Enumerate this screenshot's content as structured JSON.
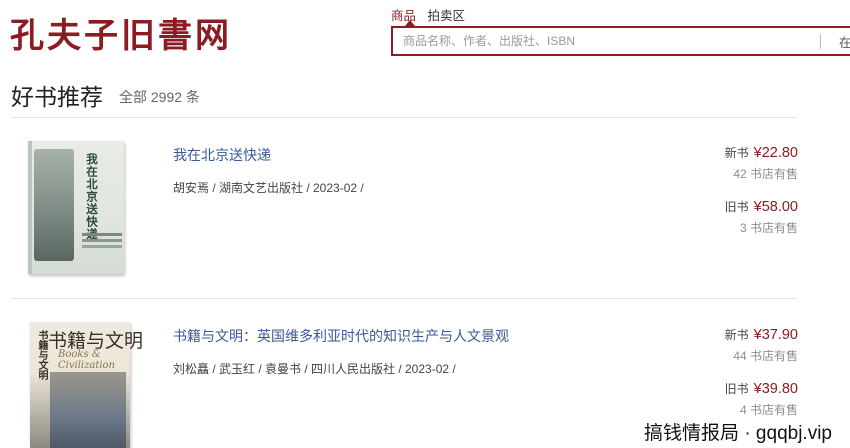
{
  "header": {
    "logo_text": "孔夫子旧書网",
    "search_tabs": [
      "商品",
      "拍卖区"
    ],
    "search_placeholder": "商品名称、作者、出版社、ISBN",
    "search_scope": "在"
  },
  "section": {
    "title": "好书推荐",
    "count_text": "全部 2992 条"
  },
  "books": [
    {
      "title": "我在北京送快递",
      "meta": "胡安焉 / 湖南文艺出版社 / 2023-02 /",
      "cover_title": "我在北京送快递",
      "new_label": "新书",
      "new_price": "¥22.80",
      "new_sellers": "42 书店有售",
      "used_label": "旧书",
      "used_price": "¥58.00",
      "used_sellers": "3 书店有售"
    },
    {
      "title": "书籍与文明：英国维多利亚时代的知识生产与人文景观",
      "meta": "刘松矗 / 武玉红 / 袁曼书 / 四川人民出版社 / 2023-02 /",
      "cover_title": "书籍与文明",
      "cover_subtitle": "Books & Civilization",
      "new_label": "新书",
      "new_price": "¥37.90",
      "new_sellers": "44 书店有售",
      "used_label": "旧书",
      "used_price": "¥39.80",
      "used_sellers": "4 书店有售"
    }
  ],
  "watermark": "搞钱情报局 · gqqbj.vip",
  "colors": {
    "brand": "#8a1c22",
    "link": "#3a5a9b",
    "muted": "#8d8d8d"
  }
}
